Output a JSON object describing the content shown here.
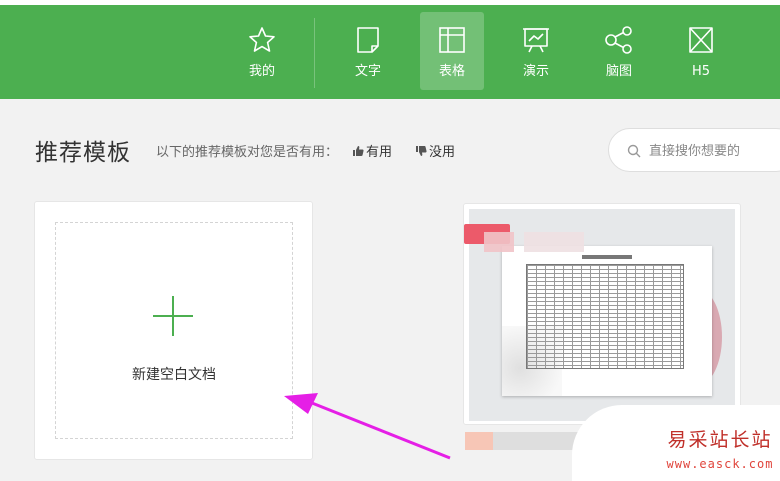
{
  "nav": {
    "items": [
      {
        "label": "我的",
        "icon": "star-icon"
      },
      {
        "label": "文字",
        "icon": "document-icon"
      },
      {
        "label": "表格",
        "icon": "spreadsheet-icon",
        "active": true
      },
      {
        "label": "演示",
        "icon": "presentation-icon"
      },
      {
        "label": "脑图",
        "icon": "mindmap-icon"
      },
      {
        "label": "H5",
        "icon": "h5-icon"
      }
    ]
  },
  "section": {
    "title": "推荐模板",
    "hint": "以下的推荐模板对您是否有用：",
    "useful": "有用",
    "useless": "没用"
  },
  "search": {
    "placeholder": "直接搜你想要的"
  },
  "new_doc": {
    "label": "新建空白文档"
  },
  "watermark": {
    "text": "易采站长站",
    "url": "www.easck.com"
  },
  "colors": {
    "brand_green": "#4caf50",
    "arrow_magenta": "#e51fe6",
    "watermark_red": "#c0302a"
  }
}
